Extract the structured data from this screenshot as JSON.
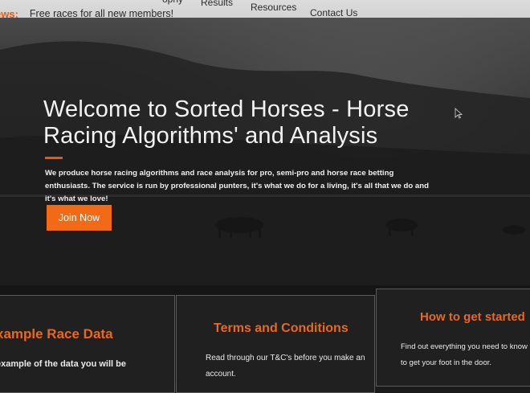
{
  "news": {
    "label": "ews:",
    "text": "Free races for all new members!"
  },
  "nav": {
    "partial_label": "ophy",
    "results_label": "Results",
    "resources_label": "Resources",
    "contact_label": "Contact Us"
  },
  "hero": {
    "title": "Welcome to Sorted Horses - Horse Racing Algorithms' and Analysis",
    "description": "We produce horse racing algorithms and race analysis for pro, semi-pro and horse race betting enthusiasts. The service is run by professional punters, it's what we do for a living, it's all that we do and it's what we love!",
    "join_label": "Join Now"
  },
  "panels": {
    "example": {
      "title": "xample Race Data",
      "text": "example of the data you will be"
    },
    "terms": {
      "title": "Terms and Conditions",
      "text": "Read through our T&C's before you make an account."
    },
    "started": {
      "title": "How to get started",
      "text": "Find out everything you need to know to get your foot in the door."
    }
  },
  "colors": {
    "accent": "#f26a15",
    "nav_background": "#d4d4d4",
    "hero_text": "#f2f2f2"
  }
}
